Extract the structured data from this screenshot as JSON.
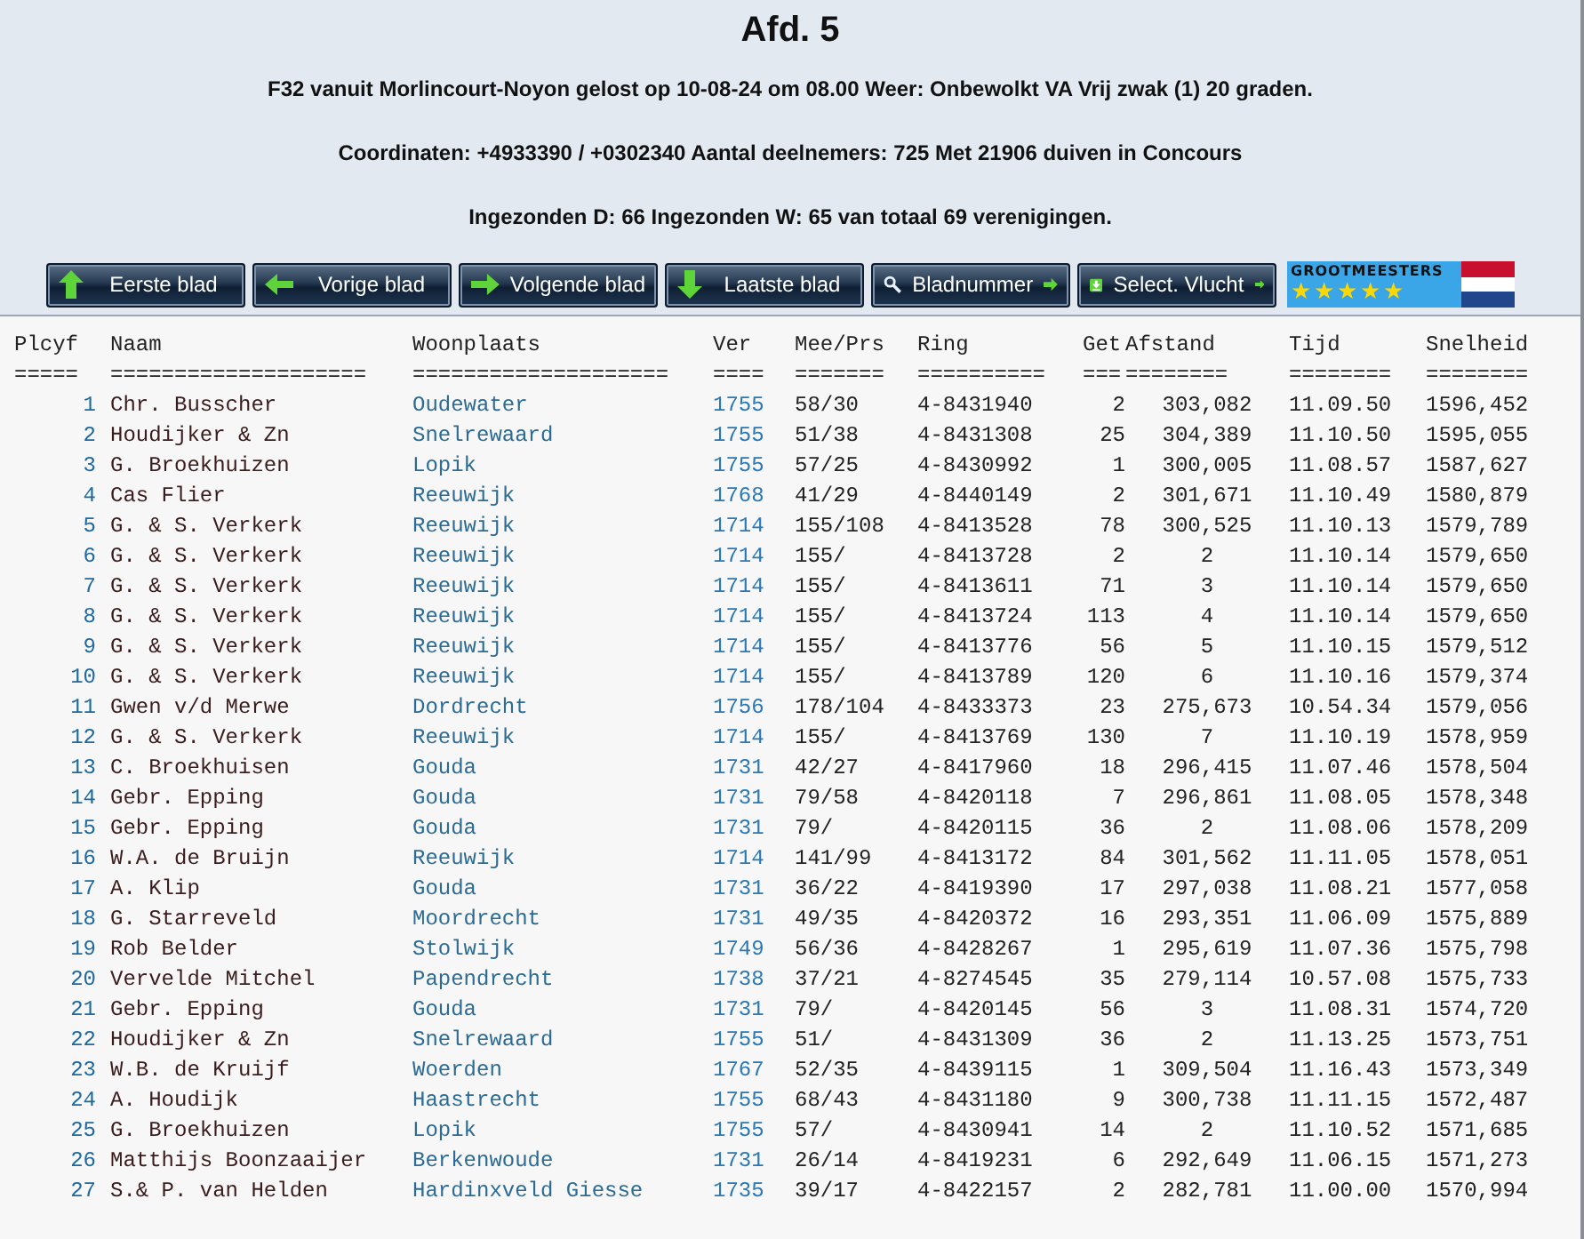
{
  "header": {
    "title": "Afd. 5",
    "lines": [
      "F32 vanuit Morlincourt-Noyon gelost op 10-08-24 om 08.00 Weer: Onbewolkt VA Vrij zwak (1) 20 graden.",
      "Coordinaten: +4933390 / +0302340 Aantal deelnemers: 725 Met 21906 duiven in Concours",
      "Ingezonden D: 66 Ingezonden W: 65 van totaal 69 verenigingen."
    ]
  },
  "toolbar": {
    "buttons": [
      {
        "label": "Eerste blad",
        "kind": "first"
      },
      {
        "label": "Vorige blad",
        "kind": "previous"
      },
      {
        "label": "Volgende blad",
        "kind": "next"
      },
      {
        "label": "Laatste blad",
        "kind": "last"
      },
      {
        "label": "Bladnummer",
        "kind": "page"
      },
      {
        "label": "Select. Vlucht",
        "kind": "flight"
      }
    ],
    "logo": {
      "text": "GROOTMEESTERS",
      "stars": 5
    }
  },
  "table": {
    "columns": [
      {
        "label": "Plcyf",
        "rule": "====="
      },
      {
        "label": "Naam",
        "rule": "===================="
      },
      {
        "label": "Woonplaats",
        "rule": "===================="
      },
      {
        "label": "Ver",
        "rule": "===="
      },
      {
        "label": "Mee/Prs",
        "rule": "======="
      },
      {
        "label": "Ring",
        "rule": "=========="
      },
      {
        "label": "Get",
        "rule": "==="
      },
      {
        "label": "Afstand",
        "rule": "========"
      },
      {
        "label": "Tijd",
        "rule": "========"
      },
      {
        "label": "Snelheid",
        "rule": "========"
      }
    ],
    "rows": [
      [
        "1",
        "Chr. Busscher",
        "Oudewater",
        "1755",
        "58/30",
        "4-8431940",
        "2",
        "303,082",
        "11.09.50",
        "1596,452"
      ],
      [
        "2",
        "Houdijker & Zn",
        "Snelrewaard",
        "1755",
        "51/38",
        "4-8431308",
        "25",
        "304,389",
        "11.10.50",
        "1595,055"
      ],
      [
        "3",
        "G. Broekhuizen",
        "Lopik",
        "1755",
        "57/25",
        "4-8430992",
        "1",
        "300,005",
        "11.08.57",
        "1587,627"
      ],
      [
        "4",
        "Cas Flier",
        "Reeuwijk",
        "1768",
        "41/29",
        "4-8440149",
        "2",
        "301,671",
        "11.10.49",
        "1580,879"
      ],
      [
        "5",
        "G. & S. Verkerk",
        "Reeuwijk",
        "1714",
        "155/108",
        "4-8413528",
        "78",
        "300,525",
        "11.10.13",
        "1579,789"
      ],
      [
        "6",
        "G. & S. Verkerk",
        "Reeuwijk",
        "1714",
        "155/",
        "4-8413728",
        "2",
        "2",
        "11.10.14",
        "1579,650"
      ],
      [
        "7",
        "G. & S. Verkerk",
        "Reeuwijk",
        "1714",
        "155/",
        "4-8413611",
        "71",
        "3",
        "11.10.14",
        "1579,650"
      ],
      [
        "8",
        "G. & S. Verkerk",
        "Reeuwijk",
        "1714",
        "155/",
        "4-8413724",
        "113",
        "4",
        "11.10.14",
        "1579,650"
      ],
      [
        "9",
        "G. & S. Verkerk",
        "Reeuwijk",
        "1714",
        "155/",
        "4-8413776",
        "56",
        "5",
        "11.10.15",
        "1579,512"
      ],
      [
        "10",
        "G. & S. Verkerk",
        "Reeuwijk",
        "1714",
        "155/",
        "4-8413789",
        "120",
        "6",
        "11.10.16",
        "1579,374"
      ],
      [
        "11",
        "Gwen v/d Merwe",
        "Dordrecht",
        "1756",
        "178/104",
        "4-8433373",
        "23",
        "275,673",
        "10.54.34",
        "1579,056"
      ],
      [
        "12",
        "G. & S. Verkerk",
        "Reeuwijk",
        "1714",
        "155/",
        "4-8413769",
        "130",
        "7",
        "11.10.19",
        "1578,959"
      ],
      [
        "13",
        "C. Broekhuisen",
        "Gouda",
        "1731",
        "42/27",
        "4-8417960",
        "18",
        "296,415",
        "11.07.46",
        "1578,504"
      ],
      [
        "14",
        "Gebr. Epping",
        "Gouda",
        "1731",
        "79/58",
        "4-8420118",
        "7",
        "296,861",
        "11.08.05",
        "1578,348"
      ],
      [
        "15",
        "Gebr. Epping",
        "Gouda",
        "1731",
        "79/",
        "4-8420115",
        "36",
        "2",
        "11.08.06",
        "1578,209"
      ],
      [
        "16",
        "W.A. de Bruijn",
        "Reeuwijk",
        "1714",
        "141/99",
        "4-8413172",
        "84",
        "301,562",
        "11.11.05",
        "1578,051"
      ],
      [
        "17",
        "A. Klip",
        "Gouda",
        "1731",
        "36/22",
        "4-8419390",
        "17",
        "297,038",
        "11.08.21",
        "1577,058"
      ],
      [
        "18",
        "G. Starreveld",
        "Moordrecht",
        "1731",
        "49/35",
        "4-8420372",
        "16",
        "293,351",
        "11.06.09",
        "1575,889"
      ],
      [
        "19",
        "Rob Belder",
        "Stolwijk",
        "1749",
        "56/36",
        "4-8428267",
        "1",
        "295,619",
        "11.07.36",
        "1575,798"
      ],
      [
        "20",
        "Vervelde Mitchel",
        "Papendrecht",
        "1738",
        "37/21",
        "4-8274545",
        "35",
        "279,114",
        "10.57.08",
        "1575,733"
      ],
      [
        "21",
        "Gebr. Epping",
        "Gouda",
        "1731",
        "79/",
        "4-8420145",
        "56",
        "3",
        "11.08.31",
        "1574,720"
      ],
      [
        "22",
        "Houdijker & Zn",
        "Snelrewaard",
        "1755",
        "51/",
        "4-8431309",
        "36",
        "2",
        "11.13.25",
        "1573,751"
      ],
      [
        "23",
        "W.B. de Kruijf",
        "Woerden",
        "1767",
        "52/35",
        "4-8439115",
        "1",
        "309,504",
        "11.16.43",
        "1573,349"
      ],
      [
        "24",
        "A. Houdijk",
        "Haastrecht",
        "1755",
        "68/43",
        "4-8431180",
        "9",
        "300,738",
        "11.11.15",
        "1572,487"
      ],
      [
        "25",
        "G. Broekhuizen",
        "Lopik",
        "1755",
        "57/",
        "4-8430941",
        "14",
        "2",
        "11.10.52",
        "1571,685"
      ],
      [
        "26",
        "Matthijs Boonzaaijer",
        "Berkenwoude",
        "1731",
        "26/14",
        "4-8419231",
        "6",
        "292,649",
        "11.06.15",
        "1571,273"
      ],
      [
        "27",
        "S.& P. van Helden",
        "Hardinxveld Giesse",
        "1735",
        "39/17",
        "4-8422157",
        "2",
        "282,781",
        "11.00.00",
        "1570,994"
      ]
    ]
  }
}
